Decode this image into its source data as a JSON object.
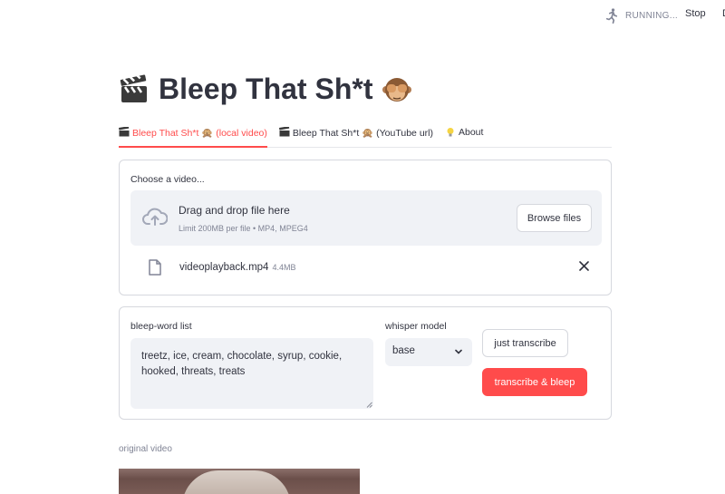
{
  "status": {
    "running_label": "RUNNING...",
    "stop_label": "Stop",
    "edge_char": "D"
  },
  "page": {
    "title_text": "Bleep That Sh*t",
    "title_emoji_left": "clapper-board-icon",
    "title_emoji_right": "see-no-evil-monkey-icon"
  },
  "tabs": [
    {
      "label": "Bleep That Sh*t 🙊 (local video)",
      "icon": "clapper-board-icon",
      "active": true
    },
    {
      "label": "Bleep That Sh*t 🙊 (YouTube url)",
      "icon": "clapper-board-icon",
      "active": false
    },
    {
      "label": "About",
      "icon": "light-bulb-icon",
      "active": false
    }
  ],
  "uploader": {
    "label": "Choose a video...",
    "drop_title": "Drag and drop file here",
    "drop_subtitle": "Limit 200MB per file • MP4, MPEG4",
    "browse_label": "Browse files",
    "file": {
      "name": "videoplayback.mp4",
      "size": "4.4MB"
    }
  },
  "form": {
    "bleep_label": "bleep-word list",
    "bleep_value": "treetz, ice, cream, chocolate, syrup, cookie, hooked, threats, treats",
    "model_label": "whisper model",
    "model_value": "base",
    "transcribe_label": "just transcribe",
    "bleep_button_label": "transcribe & bleep"
  },
  "output": {
    "original_label": "original video"
  },
  "colors": {
    "accent": "#ff4b4b",
    "text": "#31333f",
    "muted": "#808495",
    "field_bg": "#f0f2f6",
    "border": "#d6d8de"
  }
}
